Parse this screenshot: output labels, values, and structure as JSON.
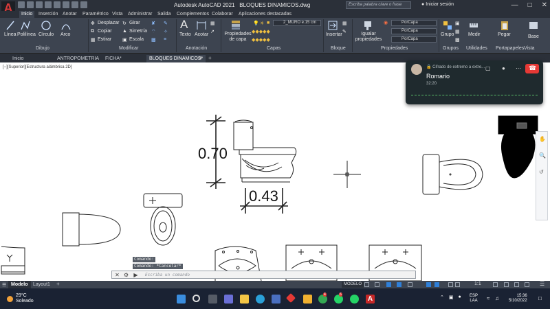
{
  "titlebar": {
    "app_name": "Autodesk AutoCAD 2021",
    "file_name": "BLOQUES DINAMICOS.dwg",
    "search_placeholder": "Escriba palabra clave o frase",
    "signin_label": "Iniciar sesión",
    "logo_letter": "A"
  },
  "ribbon_tabs": [
    "Inicio",
    "Inserción",
    "Anotar",
    "Paramétrico",
    "Vista",
    "Administrar",
    "Salida",
    "Complementos",
    "Colaborar",
    "Aplicaciones destacadas"
  ],
  "ribbon": {
    "draw": {
      "title": "Dibujo",
      "line": "Línea",
      "polyline": "Polilínea",
      "circle": "Círculo",
      "arc": "Arco"
    },
    "modify": {
      "title": "Modificar",
      "move": "Desplazar",
      "rotate": "Girar",
      "copy": "Copiar",
      "mirror": "Simetría",
      "stretch": "Estirar",
      "scale": "Escala"
    },
    "annotation": {
      "title": "Anotación",
      "text": "Texto",
      "dimension": "Acotar"
    },
    "layers": {
      "title": "Capas",
      "properties": "Propiedades de capa",
      "current_layer": "2_MURO e.15 cm"
    },
    "block": {
      "title": "Bloque",
      "insert": "Insertar"
    },
    "properties": {
      "title": "Propiedades",
      "match": "Igualar propiedades",
      "color": "PorCapa",
      "linetype": "PorCapa",
      "lineweight": "PorCapa"
    },
    "groups": {
      "title": "Grupos",
      "group": "Grupo"
    },
    "utilities": {
      "title": "Utilidades",
      "measure": "Medir"
    },
    "clipboard": {
      "title": "Portapapeles",
      "paste": "Pegar"
    },
    "view": {
      "title": "Vista",
      "base": "Base"
    }
  },
  "doc_tabs": [
    "Inicio",
    "ANTROPOMETRIA",
    "FICHA*",
    "BLOQUES DINAMICOS*"
  ],
  "viewport_label": "[−][Superior][Estructura alámbrica 2D]",
  "drawing": {
    "dim_height": "0.70",
    "dim_width": "0.43"
  },
  "command": {
    "history": [
      "Comando:",
      "Comando: *Cancelar*"
    ],
    "placeholder": "Escriba un comando"
  },
  "statusbar": {
    "layouts": [
      "Modelo",
      "Layout1"
    ],
    "model_button": "MODELO",
    "scale": "1:1"
  },
  "taskbar": {
    "temperature": "29°C",
    "weather": "Soleado",
    "lang_line1": "ESP",
    "lang_line2": "LAA",
    "time": "15:36",
    "date": "5/10/2022",
    "badge_chrome": "4",
    "badge_whatsapp": "6"
  },
  "call": {
    "encryption": "Cifrado de extremo a extre...",
    "caller": "Romario",
    "duration": "32:20"
  },
  "colors": {
    "ribbon_bg": "#3d4450",
    "titlebar_bg": "#2b3039",
    "autocad_red": "#d83a3a",
    "taskbar_bg": "#1a2233",
    "end_call_red": "#e53935"
  }
}
